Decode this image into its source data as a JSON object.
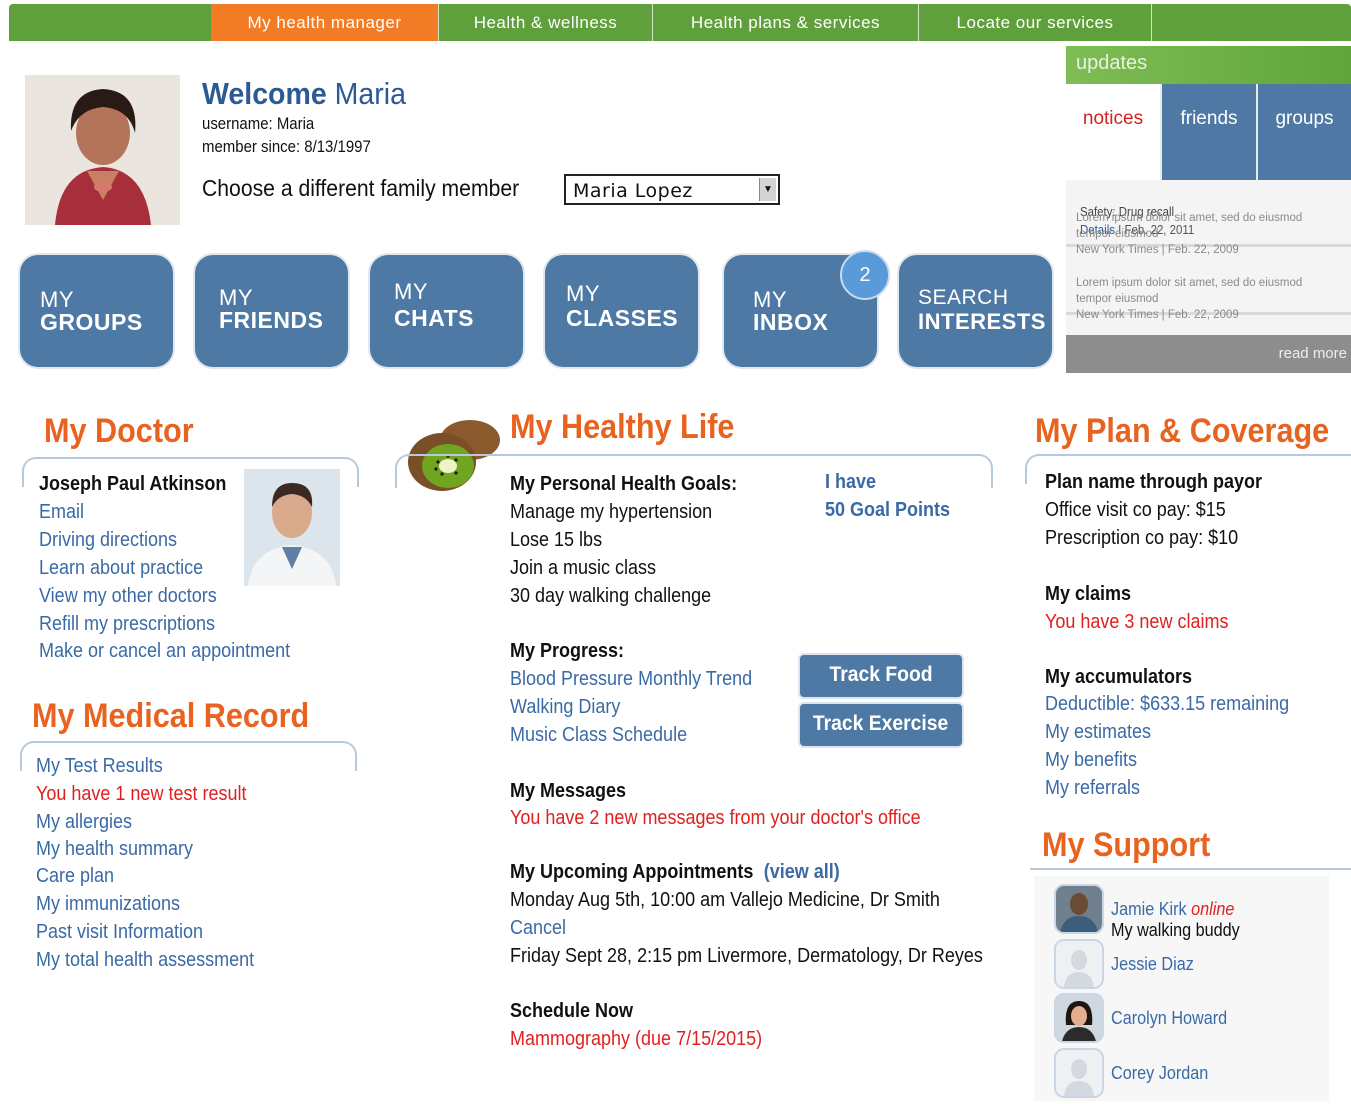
{
  "topnav": {
    "items": [
      "My health manager",
      "Health & wellness",
      "Health plans & services",
      "Locate our services"
    ],
    "active_color": "#f27c26",
    "bar_color": "#5f9f3c"
  },
  "welcome": {
    "title_prefix": "Welcome",
    "title_name": "Maria",
    "username": "username: Maria",
    "member_since": "member since: 8/13/1997",
    "choose_label": "Choose a different family member",
    "family_selected": "Maria Lopez"
  },
  "tiles": [
    {
      "l1": "MY",
      "l2": "GROUPS"
    },
    {
      "l1": "MY",
      "l2": "FRIENDS"
    },
    {
      "l1": "MY",
      "l2": "CHATS"
    },
    {
      "l1": "MY",
      "l2": "CLASSES"
    },
    {
      "l1": "MY",
      "l2": "INBOX"
    },
    {
      "l1": "SEARCH",
      "l2": "INTERESTS"
    }
  ],
  "inbox_badge": "2",
  "updates": {
    "title": "updates",
    "tabs": [
      "notices",
      "friends",
      "groups"
    ],
    "notice1_title": "Safety: Drug recall",
    "notice1_link": "Details",
    "notice1_date": " I Feb. 22, 2011",
    "notice2_l1": "Lorem ipsum dolor sit amet, sed do eiusmod",
    "notice2_l2": "tempor eiusmod",
    "notice2_l3": "New York Times | Feb. 22, 2009",
    "notice3_l1": "Lorem ipsum dolor sit amet, sed do eiusmod",
    "notice3_l2": "tempor eiusmod",
    "notice3_l3": "New York Times | Feb. 22, 2009",
    "read_more": "read more"
  },
  "doctor": {
    "section_title": "My Doctor",
    "name": "Joseph Paul Atkinson",
    "links": [
      "Email",
      "Driving directions",
      "Learn about practice",
      "View my other doctors",
      "Refill my prescriptions",
      "Make or cancel an appointment"
    ]
  },
  "medical_record": {
    "section_title": "My Medical Record",
    "test_results": "My Test Results",
    "new_result": "You have 1 new test result",
    "links": [
      "My allergies",
      "My health summary",
      "Care plan",
      "My immunizations",
      "Past visit Information",
      "My total health assessment"
    ]
  },
  "healthy_life": {
    "section_title": "My Healthy Life",
    "goals_heading": "My Personal Health Goals:",
    "goals": [
      "Manage my hypertension",
      "Lose 15 lbs",
      "Join a music class",
      "30 day walking challenge"
    ],
    "points_line1": "I have",
    "points_line2": "50 Goal Points",
    "progress_heading": "My Progress:",
    "progress_links": [
      "Blood Pressure Monthly Trend",
      "Walking Diary",
      "Music Class Schedule"
    ],
    "track_food": "Track Food",
    "track_exercise": "Track Exercise",
    "messages_heading": "My Messages",
    "messages_text": "You have 2 new messages from your doctor's office",
    "appointments_heading": "My Upcoming Appointments",
    "view_all": "(view all)",
    "appt1": "Monday Aug 5th, 10:00 am Vallejo Medicine, Dr Smith",
    "cancel": "Cancel",
    "appt2": "Friday Sept 28, 2:15 pm Livermore, Dermatology, Dr Reyes",
    "schedule_heading": "Schedule Now",
    "schedule_item": "Mammography (due 7/15/2015)"
  },
  "plan": {
    "section_title": "My Plan & Coverage",
    "plan_name": "Plan name through payor",
    "office_visit": "Office visit co pay:  $15",
    "prescription": "Prescription co pay: $10",
    "claims_heading": "My claims",
    "claims_text": "You have 3 new claims",
    "accum_heading": "My accumulators",
    "accum_links": [
      "Deductible: $633.15 remaining",
      "My estimates",
      "My benefits",
      "My referrals"
    ]
  },
  "support": {
    "section_title": "My Support",
    "people": [
      {
        "name": "Jamie Kirk",
        "status": "online",
        "note": "My walking buddy"
      },
      {
        "name": "Jessie Diaz"
      },
      {
        "name": "Carolyn Howard"
      },
      {
        "name": "Corey Jordan"
      }
    ]
  }
}
